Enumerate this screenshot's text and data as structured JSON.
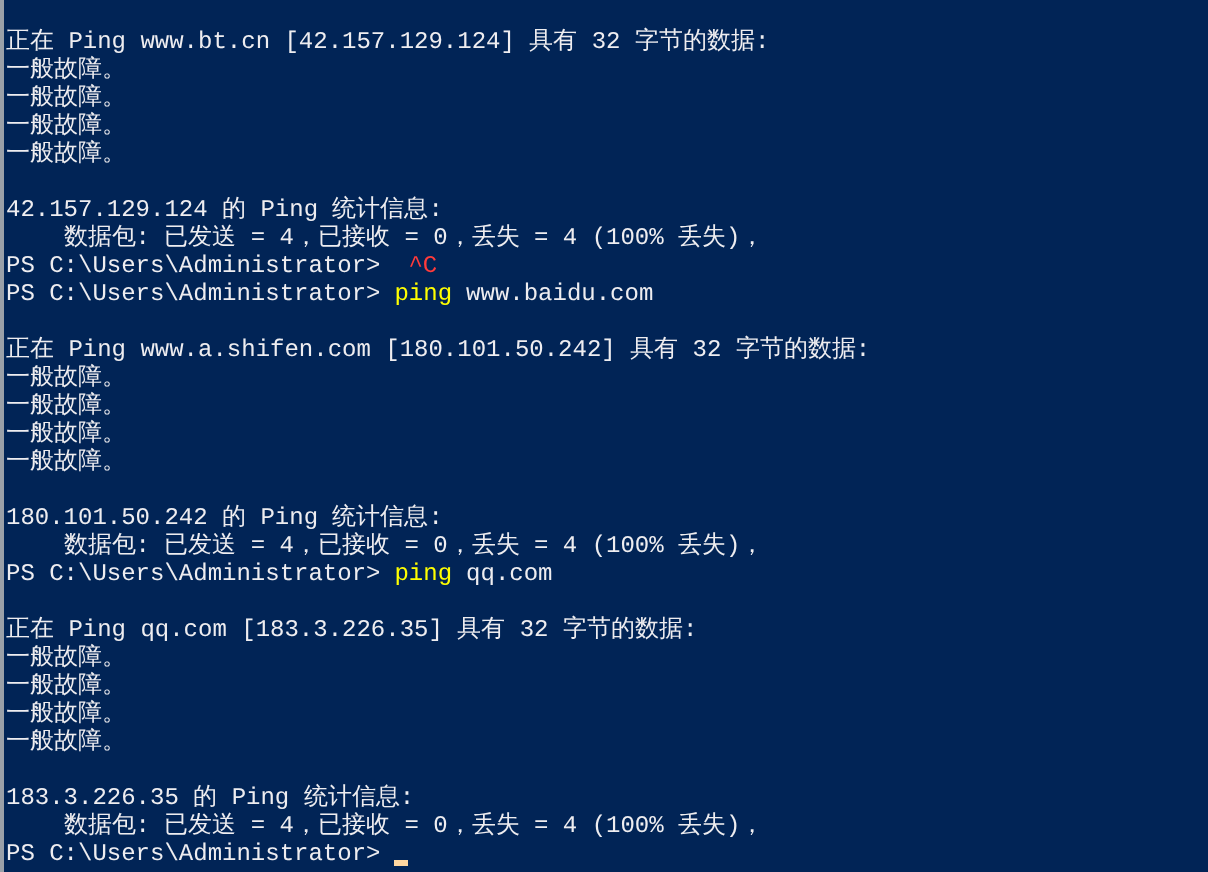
{
  "lines": [
    {
      "kind": "blank"
    },
    {
      "kind": "output",
      "text": "正在 Ping www.bt.cn [42.157.129.124] 具有 32 字节的数据:"
    },
    {
      "kind": "output",
      "text": "一般故障。"
    },
    {
      "kind": "output",
      "text": "一般故障。"
    },
    {
      "kind": "output",
      "text": "一般故障。"
    },
    {
      "kind": "output",
      "text": "一般故障。"
    },
    {
      "kind": "blank"
    },
    {
      "kind": "output",
      "text": "42.157.129.124 的 Ping 统计信息:"
    },
    {
      "kind": "output",
      "text": "    数据包: 已发送 = 4，已接收 = 0，丢失 = 4 (100% 丢失)，"
    },
    {
      "kind": "prompt",
      "prompt": "PS C:\\Users\\Administrator>",
      "interrupt": "^C"
    },
    {
      "kind": "prompt",
      "prompt": "PS C:\\Users\\Administrator>",
      "command": "ping",
      "args": "www.baidu.com"
    },
    {
      "kind": "blank"
    },
    {
      "kind": "output",
      "text": "正在 Ping www.a.shifen.com [180.101.50.242] 具有 32 字节的数据:"
    },
    {
      "kind": "output",
      "text": "一般故障。"
    },
    {
      "kind": "output",
      "text": "一般故障。"
    },
    {
      "kind": "output",
      "text": "一般故障。"
    },
    {
      "kind": "output",
      "text": "一般故障。"
    },
    {
      "kind": "blank"
    },
    {
      "kind": "output",
      "text": "180.101.50.242 的 Ping 统计信息:"
    },
    {
      "kind": "output",
      "text": "    数据包: 已发送 = 4，已接收 = 0，丢失 = 4 (100% 丢失)，"
    },
    {
      "kind": "prompt",
      "prompt": "PS C:\\Users\\Administrator>",
      "command": "ping",
      "args": "qq.com"
    },
    {
      "kind": "blank"
    },
    {
      "kind": "output",
      "text": "正在 Ping qq.com [183.3.226.35] 具有 32 字节的数据:"
    },
    {
      "kind": "output",
      "text": "一般故障。"
    },
    {
      "kind": "output",
      "text": "一般故障。"
    },
    {
      "kind": "output",
      "text": "一般故障。"
    },
    {
      "kind": "output",
      "text": "一般故障。"
    },
    {
      "kind": "blank"
    },
    {
      "kind": "output",
      "text": "183.3.226.35 的 Ping 统计信息:"
    },
    {
      "kind": "output",
      "text": "    数据包: 已发送 = 4，已接收 = 0，丢失 = 4 (100% 丢失)，"
    },
    {
      "kind": "prompt",
      "prompt": "PS C:\\Users\\Administrator>",
      "cursor": true
    }
  ]
}
